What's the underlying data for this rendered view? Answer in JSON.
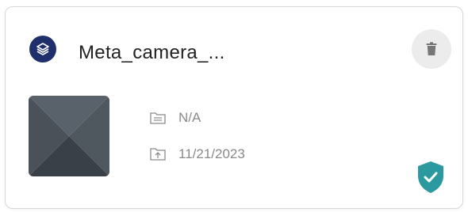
{
  "card": {
    "title": "Meta_camera_...",
    "folder": "N/A",
    "upload_date": "11/21/2023"
  },
  "icons": {
    "type_badge": "layers-icon",
    "delete": "trash-icon",
    "folder": "folder-icon",
    "upload": "upload-icon",
    "verified": "shield-check-icon"
  },
  "colors": {
    "badge_bg": "#1f2f6b",
    "delete_bg": "#ececec",
    "meta_text": "#8a8a8a",
    "verified": "#2a9aa0"
  }
}
